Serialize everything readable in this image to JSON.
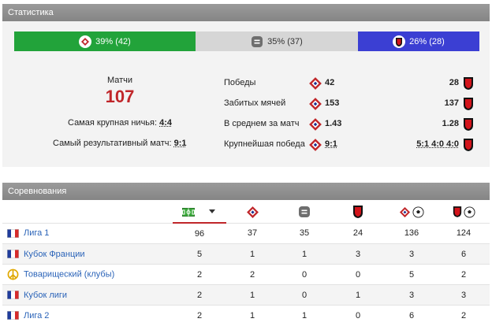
{
  "stats_section": {
    "title": "Статистика"
  },
  "outcomes": {
    "home": "39% (42)",
    "draw": "35% (37)",
    "away": "26% (28)",
    "colors": {
      "home": "#22a33a",
      "draw": "#d6d6d6",
      "away": "#3b3fd3"
    }
  },
  "summary": {
    "matches_label": "Матчи",
    "matches_count": "107",
    "biggest_draw_label": "Самая крупная ничья:",
    "biggest_draw_value": "4:4",
    "highest_scoring_label": "Самый результативный матч:",
    "highest_scoring_value": "9:1"
  },
  "head_to_head": [
    {
      "label": "Победы",
      "home": "42",
      "away": "28"
    },
    {
      "label": "Забитых мячей",
      "home": "153",
      "away": "137"
    },
    {
      "label": "В среднем за матч",
      "home": "1.43",
      "away": "1.28"
    },
    {
      "label": "Крупнейшая победа",
      "home": "9:1",
      "away": "5:1 4:0 4:0"
    }
  ],
  "competitions_section": {
    "title": "Соревнования"
  },
  "competitions": {
    "columns_icons": [
      "pitch-icon",
      "lille-crest-icon",
      "draw-icon",
      "rennes-crest-icon",
      "lille-goals-icon",
      "rennes-goals-icon"
    ],
    "rows": [
      {
        "name": "Лига 1",
        "flag": "france-flag-icon",
        "values": [
          "96",
          "37",
          "35",
          "24",
          "136",
          "124"
        ]
      },
      {
        "name": "Кубок Франции",
        "flag": "france-flag-icon",
        "values": [
          "5",
          "1",
          "1",
          "3",
          "3",
          "6"
        ]
      },
      {
        "name": "Товарищеский (клубы)",
        "flag": "peace-icon",
        "values": [
          "2",
          "2",
          "0",
          "0",
          "5",
          "2"
        ]
      },
      {
        "name": "Кубок лиги",
        "flag": "france-flag-icon",
        "values": [
          "2",
          "1",
          "0",
          "1",
          "3",
          "3"
        ]
      },
      {
        "name": "Лига 2",
        "flag": "france-flag-icon",
        "values": [
          "2",
          "1",
          "1",
          "0",
          "6",
          "2"
        ]
      }
    ]
  }
}
